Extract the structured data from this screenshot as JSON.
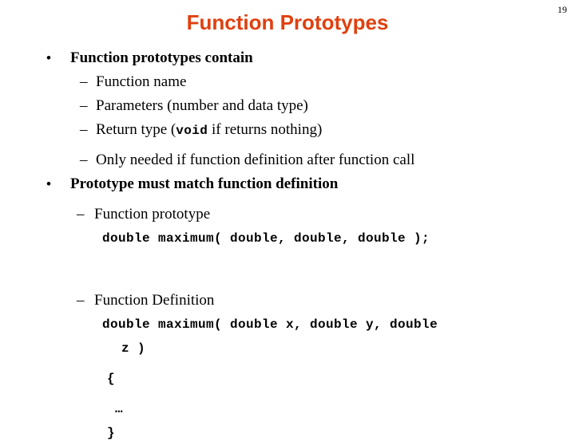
{
  "slide": {
    "page_number": "19",
    "title": "Function Prototypes",
    "title_color": "#E0400F",
    "background_color": "#FFFFFF",
    "text_color": "#000000",
    "bullet_marker": "•",
    "dash_marker": "–",
    "content": [
      {
        "level": 1,
        "text": "Function prototypes contain"
      },
      {
        "level": 2,
        "text": "Function name"
      },
      {
        "level": 2,
        "text": "Parameters (number and data type)"
      },
      {
        "level": 2,
        "text_before": "Return type (",
        "mono": "void",
        "text_after": " if returns nothing)"
      },
      {
        "level": 2,
        "text": "Only needed if function definition after function call"
      },
      {
        "level": 1,
        "text": "Prototype must match function definition"
      },
      {
        "level": 3,
        "text": "Function prototype"
      },
      {
        "level": "code",
        "text": "double maximum( double, double, double );"
      },
      {
        "level": 3,
        "text": "Function Definition"
      },
      {
        "level": "code",
        "text": "double maximum( double x, double y, double"
      },
      {
        "level": "code",
        "text": "z )"
      },
      {
        "level": "code",
        "text": "{"
      },
      {
        "level": "code",
        "text": "…"
      },
      {
        "level": "code",
        "text": "}"
      }
    ]
  }
}
